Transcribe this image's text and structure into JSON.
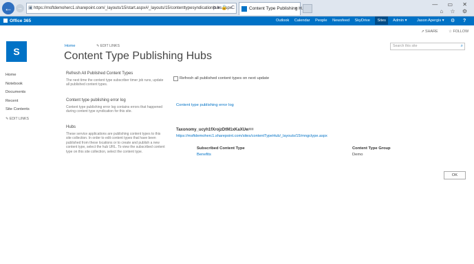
{
  "browser": {
    "address": "https://msftdemoherc1.sharepoint.com/_layouts/15/start.aspx#/_layouts/15/contenttypesyndicationhubs.aspx",
    "address_icons": "ρ▾🔒 C ×",
    "tab_title": "Content Type Publishing H...",
    "window_controls": "— ▭ ✕",
    "tool_icons": "⌂ ☆ ⚙"
  },
  "suitebar": {
    "brand": "Office 365",
    "links": [
      "Outlook",
      "Calendar",
      "People",
      "Newsfeed",
      "SkyDrive",
      "Sites"
    ],
    "admin": "Admin ▾",
    "user": "Jason Apergis ▾",
    "gear": "⚙",
    "help": "?"
  },
  "actions": {
    "share": "SHARE",
    "follow": "FOLLOW"
  },
  "header": {
    "breadcrumb": "Home",
    "edit_links": "EDIT LINKS",
    "title": "Content Type Publishing Hubs",
    "search_placeholder": "Search this site"
  },
  "leftnav": {
    "items": [
      "Home",
      "Notebook",
      "Documents",
      "Recent",
      "Site Contents"
    ],
    "edit_links": "EDIT LINKS"
  },
  "sections": {
    "refresh": {
      "title": "Refresh All Published Content Types",
      "desc": "The next time the content type subscriber timer job runs, update all published content types.",
      "checkbox_label": "Refresh all published content types on next update"
    },
    "errorlog": {
      "title": "Content type publishing error log",
      "desc": "Content type publishing error log contains errors that happened during content type syndication for this site.",
      "link": "Content type publishing error log"
    },
    "hubs": {
      "title": "Hubs",
      "desc": "These service applications are publishing content types to this site collection. In order to edit content types that have been published from these locations or to create and publish a new content type, select the hub URL. To view the subscribed content type on this site collection, select the content type.",
      "hub_name": "Taxonomy_ucyh1fXrojzDtM1xKaXUw==",
      "hub_url": "https://msftdemoherc1.sharepoint.com/sites/contentTypeHub/_layouts/15/mngctype.aspx",
      "col_subscribed": "Subscribed Content Type",
      "col_group": "Content Type Group",
      "rows": [
        {
          "content_type": "Benefits",
          "group": "Demo"
        }
      ]
    }
  },
  "ok_label": "OK"
}
